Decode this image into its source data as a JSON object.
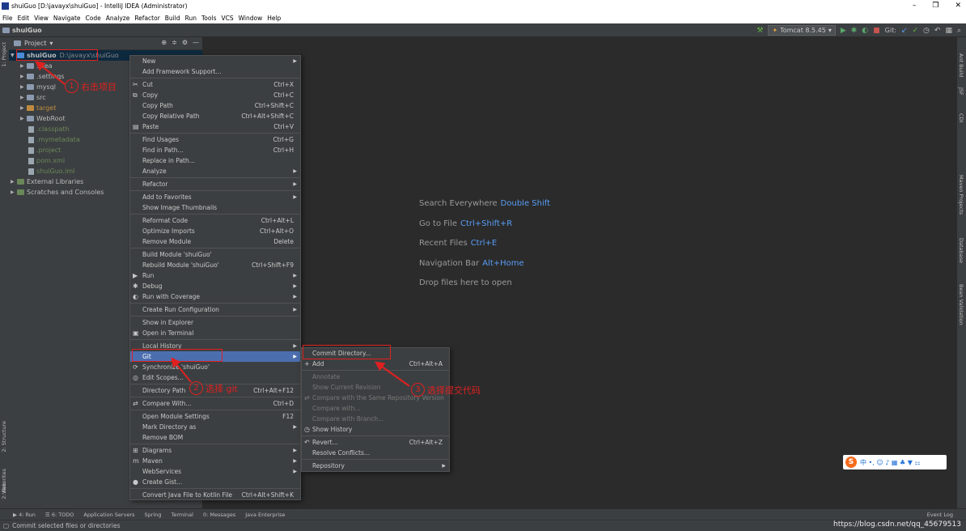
{
  "window": {
    "title": "shuiGuo [D:\\javayx\\shuiGuo] - IntelliJ IDEA (Administrator)",
    "controls": [
      "–",
      "❐",
      "✕"
    ]
  },
  "menubar": [
    "File",
    "Edit",
    "View",
    "Navigate",
    "Code",
    "Analyze",
    "Refactor",
    "Build",
    "Run",
    "Tools",
    "VCS",
    "Window",
    "Help"
  ],
  "navbar": {
    "crumb": "shuiGuo",
    "run_config": "Tomcat 8.5.45",
    "git_label": "Git:"
  },
  "project_panel": {
    "title": "Project",
    "tree": [
      {
        "label": "shuiGuo",
        "path": "D:\\javayx\\shuiGuo",
        "level": 0,
        "arrow": "▼",
        "kind": "module"
      },
      {
        "label": ".idea",
        "level": 1,
        "arrow": "▶",
        "kind": "folder"
      },
      {
        "label": ".settings",
        "level": 1,
        "arrow": "▶",
        "kind": "folder"
      },
      {
        "label": "mysql",
        "level": 1,
        "arrow": "▶",
        "kind": "folder"
      },
      {
        "label": "src",
        "level": 1,
        "arrow": "▶",
        "kind": "folder"
      },
      {
        "label": "target",
        "level": 1,
        "arrow": "▶",
        "kind": "folder-orange"
      },
      {
        "label": "WebRoot",
        "level": 1,
        "arrow": "▶",
        "kind": "folder"
      },
      {
        "label": ".classpath",
        "level": 1,
        "arrow": "",
        "kind": "file"
      },
      {
        "label": ".mymetadata",
        "level": 1,
        "arrow": "",
        "kind": "file"
      },
      {
        "label": ".project",
        "level": 1,
        "arrow": "",
        "kind": "file"
      },
      {
        "label": "pom.xml",
        "level": 1,
        "arrow": "",
        "kind": "file"
      },
      {
        "label": "shuiGuo.iml",
        "level": 1,
        "arrow": "",
        "kind": "file"
      },
      {
        "label": "External Libraries",
        "level": 0,
        "arrow": "▶",
        "kind": "lib"
      },
      {
        "label": "Scratches and Consoles",
        "level": 0,
        "arrow": "▶",
        "kind": "lib"
      }
    ]
  },
  "left_strip": {
    "project": "1: Project",
    "structure": "2: Structure",
    "favorites": "2: Favorites",
    "web": "Web"
  },
  "right_strip": [
    "Ant Build",
    "JSF",
    "CDI",
    "Maven Projects",
    "Database",
    "Bean Validation"
  ],
  "editor_hints": [
    {
      "text": "Search Everywhere",
      "key": "Double Shift"
    },
    {
      "text": "Go to File",
      "key": "Ctrl+Shift+R"
    },
    {
      "text": "Recent Files",
      "key": "Ctrl+E"
    },
    {
      "text": "Navigation Bar",
      "key": "Alt+Home"
    },
    {
      "text": "Drop files here to open",
      "key": ""
    }
  ],
  "context_menu": [
    {
      "label": "New",
      "sub": true
    },
    {
      "label": "Add Framework Support..."
    },
    {
      "sep": true
    },
    {
      "label": "Cut",
      "shortcut": "Ctrl+X",
      "icon": "✂"
    },
    {
      "label": "Copy",
      "shortcut": "Ctrl+C",
      "icon": "⧉"
    },
    {
      "label": "Copy Path",
      "shortcut": "Ctrl+Shift+C"
    },
    {
      "label": "Copy Relative Path",
      "shortcut": "Ctrl+Alt+Shift+C"
    },
    {
      "label": "Paste",
      "shortcut": "Ctrl+V",
      "icon": "▤"
    },
    {
      "sep": true
    },
    {
      "label": "Find Usages",
      "shortcut": "Ctrl+G"
    },
    {
      "label": "Find in Path...",
      "shortcut": "Ctrl+H"
    },
    {
      "label": "Replace in Path..."
    },
    {
      "label": "Analyze",
      "sub": true
    },
    {
      "sep": true
    },
    {
      "label": "Refactor",
      "sub": true
    },
    {
      "sep": true
    },
    {
      "label": "Add to Favorites",
      "sub": true
    },
    {
      "label": "Show Image Thumbnails"
    },
    {
      "sep": true
    },
    {
      "label": "Reformat Code",
      "shortcut": "Ctrl+Alt+L"
    },
    {
      "label": "Optimize Imports",
      "shortcut": "Ctrl+Alt+O"
    },
    {
      "label": "Remove Module",
      "shortcut": "Delete"
    },
    {
      "sep": true
    },
    {
      "label": "Build Module 'shuiGuo'"
    },
    {
      "label": "Rebuild Module 'shuiGuo'",
      "shortcut": "Ctrl+Shift+F9"
    },
    {
      "label": "Run",
      "sub": true,
      "icon": "▶"
    },
    {
      "label": "Debug",
      "sub": true,
      "icon": "✱"
    },
    {
      "label": "Run with Coverage",
      "sub": true,
      "icon": "◐"
    },
    {
      "sep": true
    },
    {
      "label": "Create Run Configuration",
      "sub": true
    },
    {
      "sep": true
    },
    {
      "label": "Show in Explorer"
    },
    {
      "label": "Open in Terminal",
      "icon": "▣"
    },
    {
      "sep": true
    },
    {
      "label": "Local History",
      "sub": true
    },
    {
      "label": "Git",
      "sub": true,
      "active": true
    },
    {
      "label": "Synchronize 'shuiGuo'",
      "icon": "⟳"
    },
    {
      "label": "Edit Scopes...",
      "icon": "◎"
    },
    {
      "sep": true
    },
    {
      "label": "Directory Path",
      "shortcut": "Ctrl+Alt+F12"
    },
    {
      "sep": true
    },
    {
      "label": "Compare With...",
      "shortcut": "Ctrl+D",
      "icon": "⇄"
    },
    {
      "sep": true
    },
    {
      "label": "Open Module Settings",
      "shortcut": "F12"
    },
    {
      "label": "Mark Directory as",
      "sub": true
    },
    {
      "label": "Remove BOM"
    },
    {
      "sep": true
    },
    {
      "label": "Diagrams",
      "sub": true,
      "icon": "⊞"
    },
    {
      "label": "Maven",
      "sub": true,
      "icon": "m"
    },
    {
      "label": "WebServices",
      "sub": true
    },
    {
      "label": "Create Gist...",
      "icon": "●"
    },
    {
      "sep": true
    },
    {
      "label": "Convert Java File to Kotlin File",
      "shortcut": "Ctrl+Alt+Shift+K"
    }
  ],
  "git_submenu": [
    {
      "label": "Commit Directory..."
    },
    {
      "label": "Add",
      "shortcut": "Ctrl+Alt+A",
      "icon": "+"
    },
    {
      "sep": true
    },
    {
      "label": "Annotate",
      "disabled": true
    },
    {
      "label": "Show Current Revision",
      "disabled": true
    },
    {
      "label": "Compare with the Same Repository Version",
      "disabled": true,
      "icon": "⇄"
    },
    {
      "label": "Compare with...",
      "disabled": true
    },
    {
      "label": "Compare with Branch...",
      "disabled": true
    },
    {
      "label": "Show History",
      "icon": "◷"
    },
    {
      "sep": true
    },
    {
      "label": "Revert...",
      "shortcut": "Ctrl+Alt+Z",
      "icon": "↶"
    },
    {
      "label": "Resolve Conflicts..."
    },
    {
      "sep": true
    },
    {
      "label": "Repository",
      "sub": true
    }
  ],
  "annotations": {
    "step1": {
      "num": "1",
      "text": "右击项目"
    },
    "step2": {
      "num": "2",
      "text": "选择 git"
    },
    "step3": {
      "num": "3",
      "text": "选择提交代码"
    }
  },
  "bottom_tools": [
    "▶ 4: Run",
    "☰ 6: TODO",
    "Application Servers",
    "Spring",
    "Terminal",
    "0: Messages",
    "Java Enterprise"
  ],
  "event_log": "Event Log",
  "status_text": "Commit selected files or directories",
  "watermark": "https://blog.csdn.net/qq_45679513",
  "ime_logo": "S",
  "ime_icons": "中 •, ☺ ♪ ▦ ♣ ▼ ⚏",
  "colors": {
    "accent": "#4b6eaf",
    "annotation": "#e02020",
    "link": "#589df6"
  }
}
